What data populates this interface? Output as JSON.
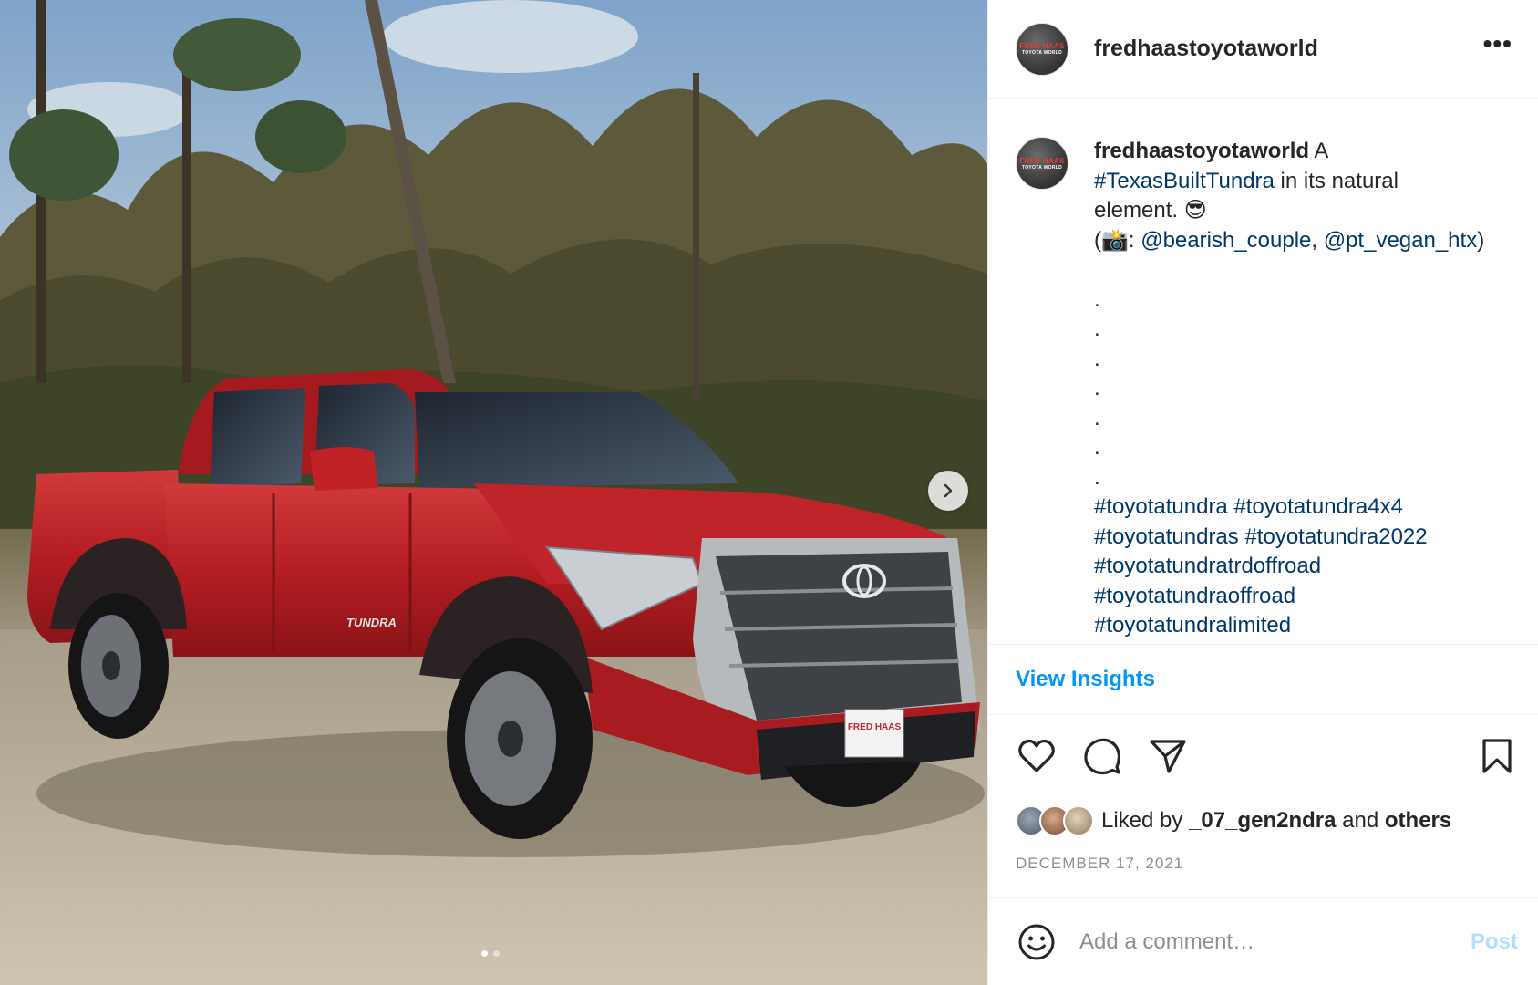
{
  "header": {
    "username": "fredhaastoyotaworld",
    "avatar_logo_top": "FRED HAAS",
    "avatar_logo_bottom": "TOYOTA WORLD",
    "more_label": "•••"
  },
  "caption": {
    "username": "fredhaastoyotaworld",
    "text_1": " A",
    "hashtag_main": "#TexasBuiltTundra",
    "text_2": " in its natural",
    "text_3": "element. 😎",
    "credit_open": "(📸: ",
    "mention_1": "@bearish_couple",
    "credit_sep": ", ",
    "mention_2": "@pt_vegan_htx",
    "credit_close": ")",
    "dots": [
      ".",
      ".",
      ".",
      ".",
      ".",
      ".",
      "."
    ],
    "hashtags": {
      "h1": "#toyotatundra",
      "h2": "#toyotatundra4x4",
      "h3": "#toyotatundras",
      "h4": "#toyotatundra2022",
      "h5": "#toyotatundratrdoffroad",
      "h6": "#toyotatundraoffroad",
      "h7": "#toyotatundralimited"
    }
  },
  "insights": {
    "label": "View Insights"
  },
  "likes": {
    "prefix": "Liked by ",
    "user": "_07_gen2ndra",
    "middle": " and ",
    "others": "others"
  },
  "date": "DECEMBER 17, 2021",
  "comment": {
    "placeholder": "Add a comment…",
    "post_label": "Post"
  },
  "media": {
    "carousel_count": 2,
    "active_index": 0,
    "plate_text": "FRED HAAS",
    "badge_text": "TUNDRA"
  },
  "icons": {
    "more": "more-horizontal-icon",
    "next": "chevron-right-icon",
    "like": "heart-icon",
    "comment": "comment-bubble-icon",
    "share": "paper-plane-icon",
    "save": "bookmark-icon",
    "emoji": "smiley-icon"
  },
  "colors": {
    "link": "#00376b",
    "insights": "#0095f6",
    "post_disabled": "#b2dffc",
    "truck": "#b81f24"
  }
}
